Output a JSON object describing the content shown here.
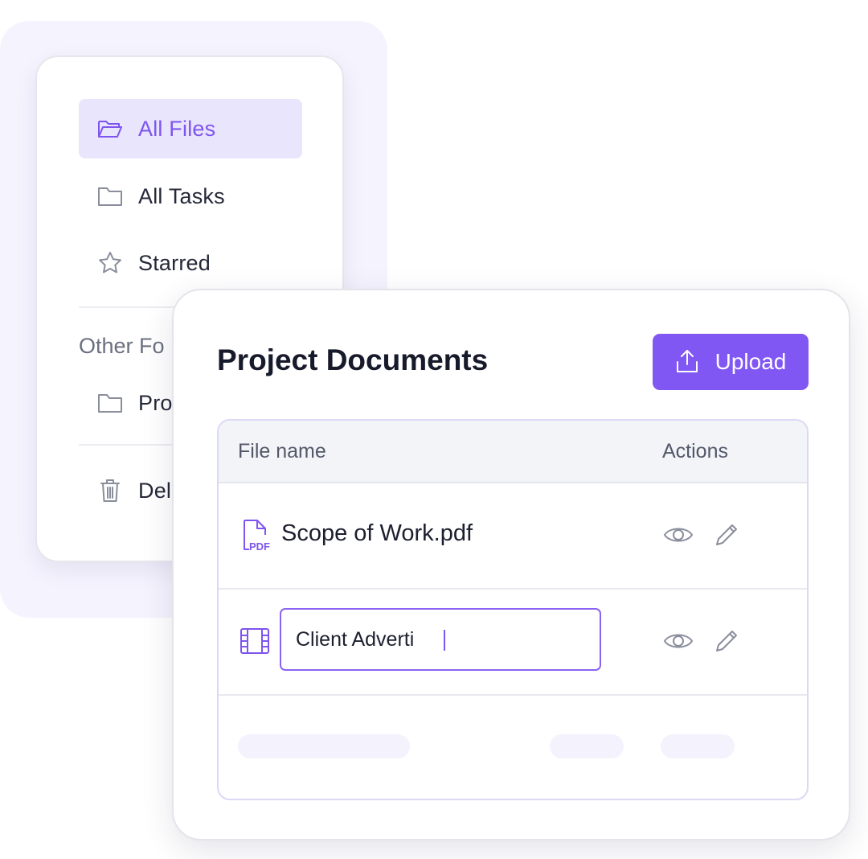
{
  "sidebar": {
    "items": [
      {
        "label": "All Files",
        "icon": "folder-open-icon",
        "active": true
      },
      {
        "label": "All Tasks",
        "icon": "folder-icon"
      },
      {
        "label": "Starred",
        "icon": "star-icon"
      }
    ],
    "section_label": "Other Fo",
    "other_items": [
      {
        "label": "Pro",
        "icon": "folder-icon"
      }
    ],
    "trash_item": {
      "label": "Del",
      "icon": "trash-icon"
    }
  },
  "documents": {
    "title": "Project Documents",
    "upload_label": "Upload",
    "upload_icon": "upload-icon",
    "columns": {
      "name": "File name",
      "actions": "Actions"
    },
    "rows": [
      {
        "name": "Scope of Work.pdf",
        "icon": "pdf-file-icon",
        "editing": false
      },
      {
        "name": "Client Adverti",
        "icon": "video-file-icon",
        "editing": true
      }
    ]
  },
  "colors": {
    "accent": "#8157f3",
    "accent_light": "#e9e5fd",
    "muted_icon": "#8a8e9c",
    "background_tint": "#f5f3fe"
  }
}
